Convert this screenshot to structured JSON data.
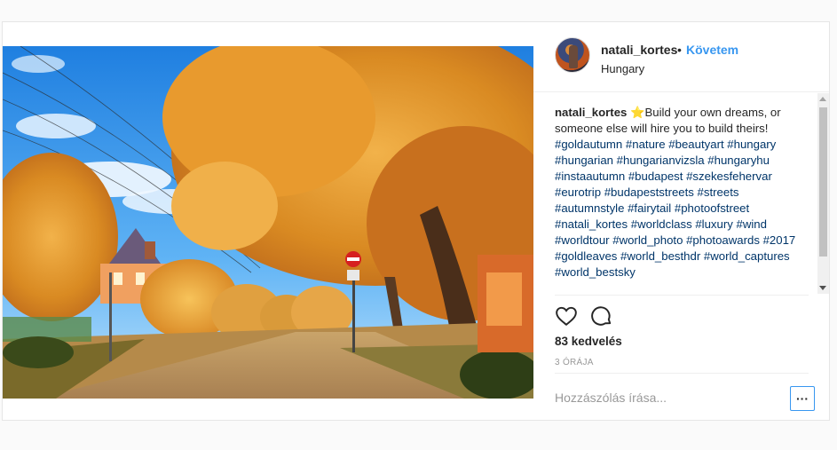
{
  "post": {
    "username": "natali_kortes",
    "separator": "•",
    "follow_label": "Követem",
    "location": "Hungary",
    "caption": {
      "username": "natali_kortes",
      "emoji": "⭐",
      "text": "Build your own dreams, or someone else will hire you to build theirs!",
      "hashtags": "#goldautumn #nature #beautyart #hungary #hungarian #hungarianvizsla #hungaryhu #instaautumn #budapest #szekesfehervar #eurotrip #budapeststreets #streets #autumnstyle #fairytail #photoofstreet #natali_kortes #worldclass #luxury #wind #worldtour #world_photo #photoawards #2017 #goldleaves #world_besthdr #world_captures #world_bestsky"
    },
    "likes": "83 kedvelés",
    "time": "3 ÓRÁJA",
    "comment_placeholder": "Hozzászólás írása...",
    "more_label": "···"
  },
  "icons": {
    "like": "heart-icon",
    "comment": "comment-bubble-icon",
    "more": "ellipsis-icon"
  },
  "colors": {
    "follow_blue": "#3897f0",
    "hashtag": "#003569",
    "text": "#262626",
    "muted": "#999999"
  }
}
